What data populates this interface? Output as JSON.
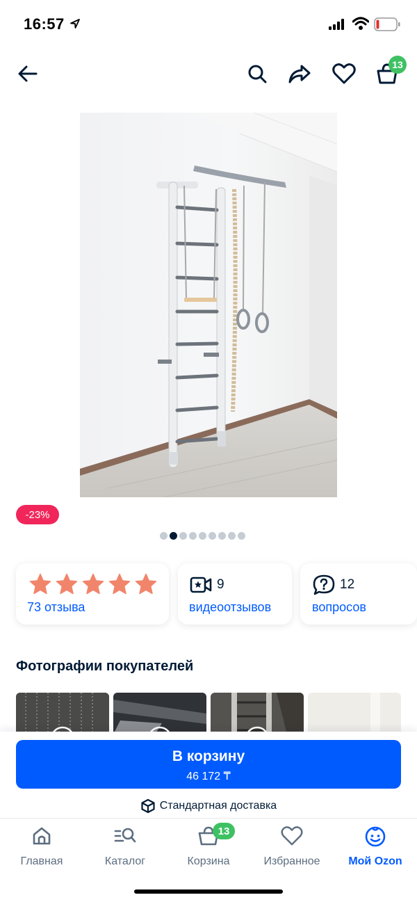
{
  "status_bar": {
    "time": "16:57"
  },
  "top_nav": {
    "cart_count": "13",
    "icons": [
      "back-arrow-icon",
      "search-icon",
      "share-icon",
      "heart-icon",
      "cart-icon"
    ]
  },
  "product": {
    "discount": "-23%",
    "gallery_total": 9,
    "gallery_active_index": 1
  },
  "cards": {
    "reviews": {
      "count_label": "73 отзыва",
      "rating_stars": 5
    },
    "video_reviews": {
      "count": "9",
      "label": "видеоотзывов"
    },
    "questions": {
      "count": "12",
      "label": "вопросов"
    }
  },
  "customer_photos": {
    "title": "Фотографии покупателей"
  },
  "buy_panel": {
    "button_label": "В корзину",
    "price": "46 172 ₸",
    "delivery": "Стандартная доставка"
  },
  "tab_bar": {
    "items": [
      {
        "label": "Главная",
        "icon": "home-icon"
      },
      {
        "label": "Каталог",
        "icon": "catalog-icon"
      },
      {
        "label": "Корзина",
        "icon": "cart-icon",
        "badge": "13"
      },
      {
        "label": "Избранное",
        "icon": "heart-icon"
      },
      {
        "label": "Мой Ozon",
        "icon": "profile-icon",
        "active": true
      }
    ]
  },
  "colors": {
    "accent": "#005bff",
    "badge_green": "#3ec163",
    "discount": "#f0265a",
    "star": "#f1856b",
    "text": "#001a34"
  }
}
